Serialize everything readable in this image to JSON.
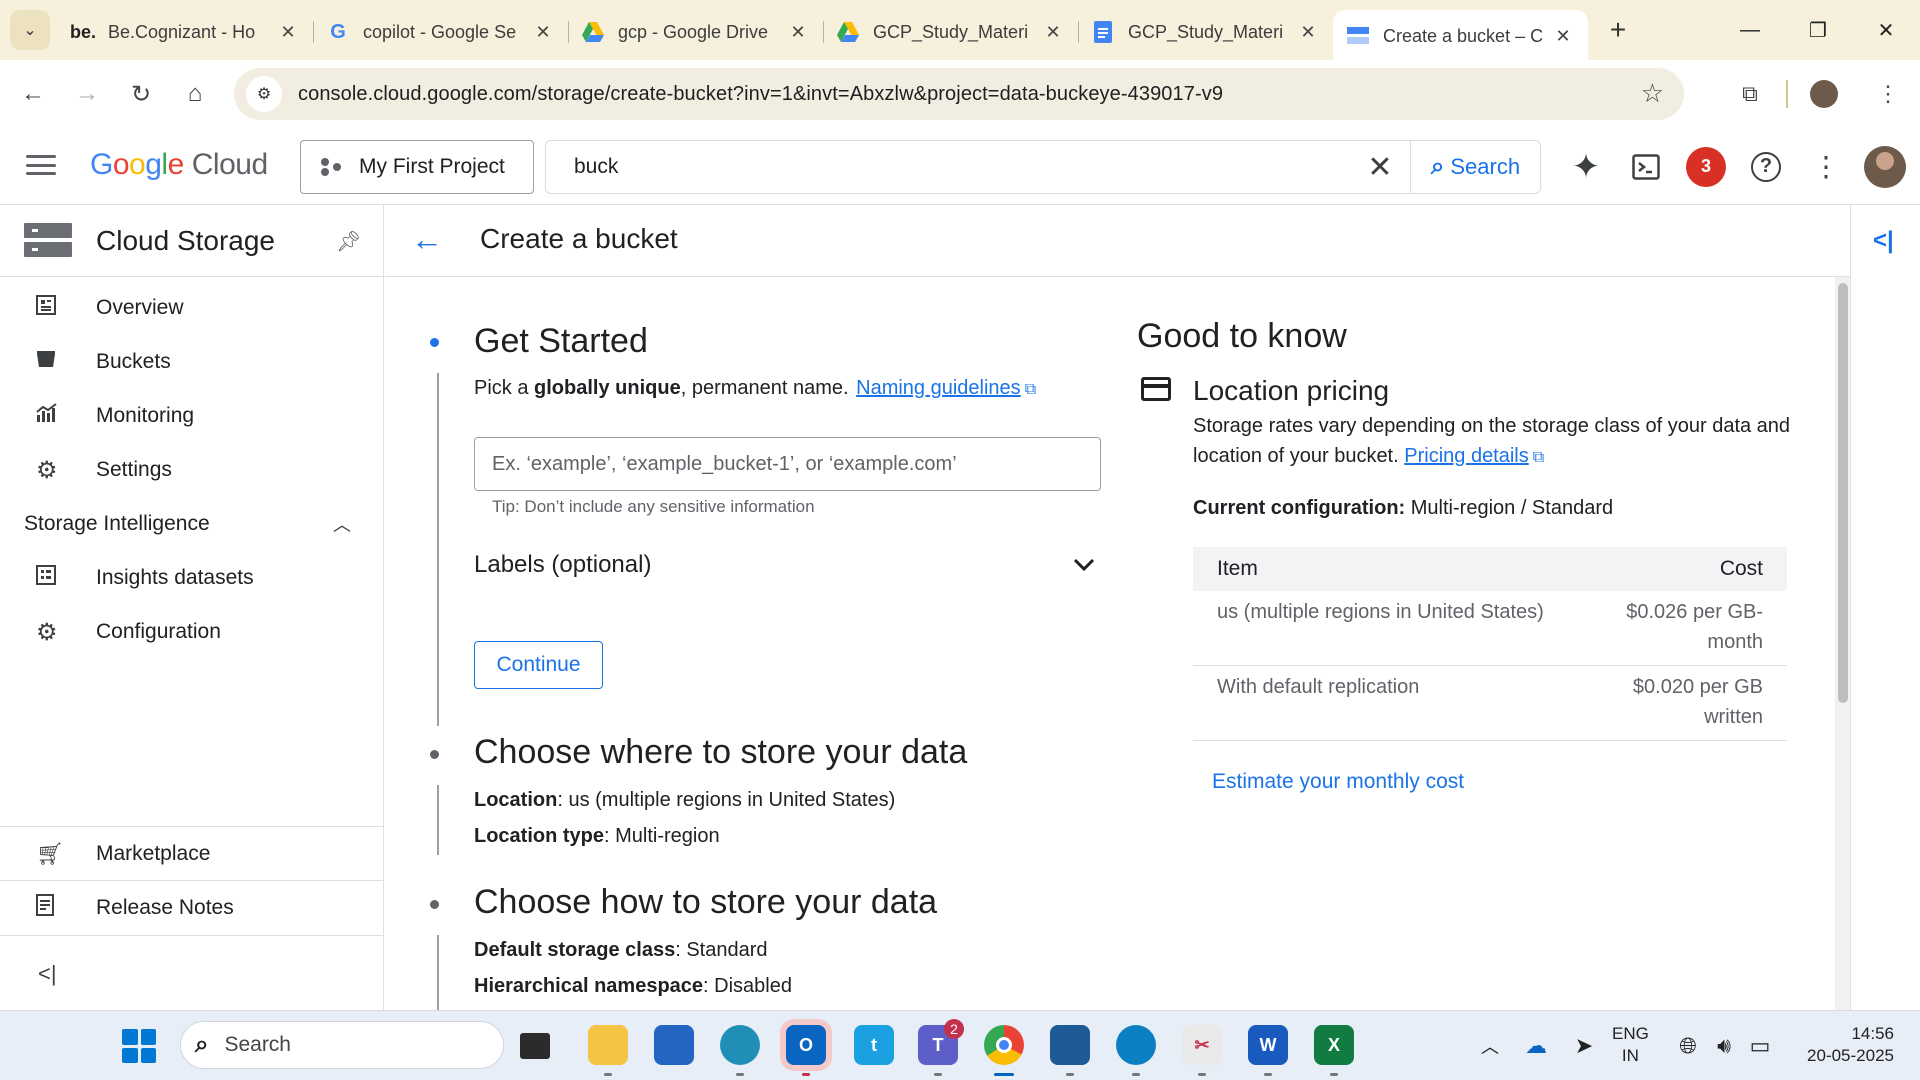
{
  "browser": {
    "tabs": [
      {
        "title": "Be.Cognizant - Ho",
        "icon": "be"
      },
      {
        "title": "copilot - Google Se",
        "icon": "G"
      },
      {
        "title": "gcp - Google Drive",
        "icon": "drive"
      },
      {
        "title": "GCP_Study_Materi",
        "icon": "drive"
      },
      {
        "title": "GCP_Study_Materi",
        "icon": "docs"
      },
      {
        "title": "Create a bucket – C",
        "icon": "gcp",
        "active": true
      }
    ],
    "url": "console.cloud.google.com/storage/create-bucket?inv=1&invt=Abxzlw&project=data-buckeye-439017-v9"
  },
  "gcp_header": {
    "logo_google": "Google",
    "logo_cloud": "Cloud",
    "project": "My First Project",
    "search_query": "buck",
    "search_button": "Search",
    "notification_count": "3"
  },
  "sidebar": {
    "product": "Cloud Storage",
    "items": [
      {
        "label": "Overview",
        "icon": "overview-icon"
      },
      {
        "label": "Buckets",
        "icon": "bucket-icon"
      },
      {
        "label": "Monitoring",
        "icon": "monitoring-icon"
      },
      {
        "label": "Settings",
        "icon": "gear-icon"
      }
    ],
    "section": "Storage Intelligence",
    "section_items": [
      {
        "label": "Insights datasets",
        "icon": "dataset-icon"
      },
      {
        "label": "Configuration",
        "icon": "gear-icon"
      }
    ],
    "bottom_items": [
      {
        "label": "Marketplace",
        "icon": "cart-icon"
      },
      {
        "label": "Release Notes",
        "icon": "notes-icon"
      }
    ]
  },
  "main": {
    "page_title": "Create a bucket",
    "step1": {
      "title": "Get Started",
      "desc_pre": "Pick a ",
      "desc_bold": "globally unique",
      "desc_post": ", permanent name.",
      "link": "Naming guidelines",
      "placeholder": "Ex. ‘example’, ‘example_bucket-1’, or ‘example.com’",
      "tip": "Tip: Don’t include any sensitive information",
      "labels": "Labels (optional)",
      "continue": "Continue"
    },
    "step2": {
      "title": "Choose where to store your data",
      "location_label": "Location",
      "location_value": ": us (multiple regions in United States)",
      "type_label": "Location type",
      "type_value": ": Multi-region"
    },
    "step3": {
      "title": "Choose how to store your data",
      "class_label": "Default storage class",
      "class_value": ": Standard",
      "ns_label": "Hierarchical namespace",
      "ns_value": ": Disabled"
    }
  },
  "good_to_know": {
    "title": "Good to know",
    "lp_title": "Location pricing",
    "lp_text": "Storage rates vary depending on the storage class of your data and location of your bucket.",
    "lp_link": "Pricing details",
    "current_label": "Current configuration:",
    "current_value": " Multi-region / Standard",
    "table": {
      "headers": [
        "Item",
        "Cost"
      ],
      "rows": [
        [
          "us (multiple regions in United States)",
          "$0.026 per GB-month"
        ],
        [
          "With default replication",
          "$0.020 per GB written"
        ]
      ]
    },
    "estimate": "Estimate your monthly cost"
  },
  "taskbar": {
    "search": "Search",
    "teams_badge": "2",
    "lang1": "ENG",
    "lang2": "IN",
    "time": "14:56",
    "date": "20-05-2025"
  }
}
